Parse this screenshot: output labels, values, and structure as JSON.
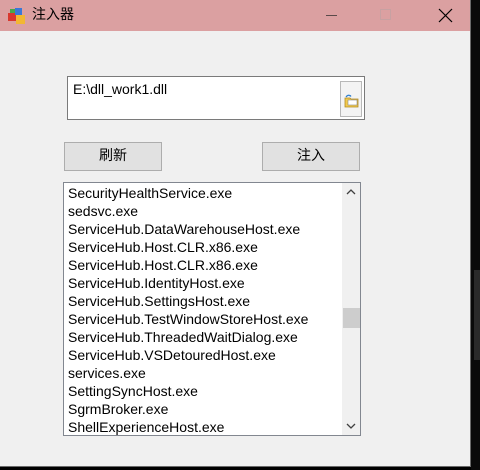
{
  "window": {
    "title": "注入器"
  },
  "controls": {
    "minimize_icon": "minimize-icon",
    "maximize_icon": "maximize-icon",
    "close_icon": "close-icon"
  },
  "path_field": {
    "value": "E:\\dll_work1.dll"
  },
  "buttons": {
    "refresh_label": "刷新",
    "inject_label": "注入"
  },
  "process_list": {
    "items": [
      "SecurityHealthService.exe",
      "sedsvc.exe",
      "ServiceHub.DataWarehouseHost.exe",
      "ServiceHub.Host.CLR.x86.exe",
      "ServiceHub.Host.CLR.x86.exe",
      "ServiceHub.IdentityHost.exe",
      "ServiceHub.SettingsHost.exe",
      "ServiceHub.TestWindowStoreHost.exe",
      "ServiceHub.ThreadedWaitDialog.exe",
      "ServiceHub.VSDetouredHost.exe",
      "services.exe",
      "SettingSyncHost.exe",
      "SgrmBroker.exe",
      "ShellExperienceHost.exe"
    ]
  },
  "colors": {
    "titlebar": "#dba0a1",
    "window_bg": "#f0f0f0",
    "button_bg": "#e1e1e1"
  }
}
